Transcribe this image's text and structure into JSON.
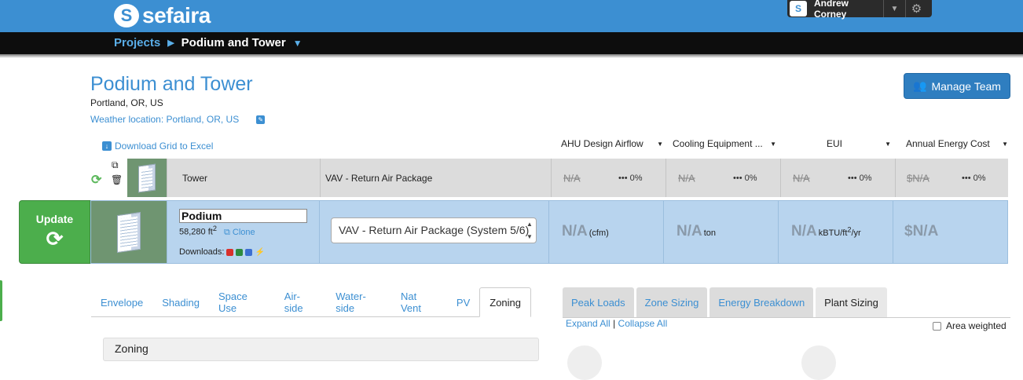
{
  "header": {
    "logo_text": "sefaira",
    "logo_mark": "S",
    "user_name": "Andrew Corney"
  },
  "breadcrumb": {
    "root": "Projects",
    "current": "Podium and Tower"
  },
  "project": {
    "title": "Podium and Tower",
    "location": "Portland, OR, US",
    "weather": "Weather location: Portland, OR, US",
    "manage_team": "Manage Team"
  },
  "grid": {
    "download_label": "Download Grid to Excel",
    "columns": [
      "AHU Design Airflow",
      "Cooling Equipment ...",
      "EUI",
      "Annual Energy Cost"
    ]
  },
  "tower_row": {
    "name": "Tower",
    "hvac": "VAV - Return Air Package",
    "metrics": [
      {
        "value": "N/A",
        "pct": "0%"
      },
      {
        "value": "N/A",
        "pct": "0%"
      },
      {
        "value": "N/A",
        "pct": "0%"
      },
      {
        "value": "$N/A",
        "pct": "0%"
      }
    ]
  },
  "podium_row": {
    "update_label": "Update",
    "name": "Podium",
    "area": "58,280 ft",
    "area_sup": "2",
    "clone": "Clone",
    "downloads_label": "Downloads:",
    "hvac": "VAV - Return Air Package (System 5/6)",
    "metrics": [
      {
        "value": "N/A",
        "unit": "(cfm)"
      },
      {
        "value": "N/A",
        "unit": "ton"
      },
      {
        "value": "N/A",
        "unit": "kBTU/ft",
        "unit_sup": "2",
        "unit_tail": "/yr"
      },
      {
        "value": "$N/A",
        "unit": ""
      }
    ]
  },
  "left_tabs": [
    "Envelope",
    "Shading",
    "Space Use",
    "Air-side",
    "Water-side",
    "Nat Vent",
    "PV",
    "Zoning"
  ],
  "left_active": "Zoning",
  "zoning_panel_title": "Zoning",
  "right_tabs": [
    "Peak Loads",
    "Zone Sizing",
    "Energy Breakdown",
    "Plant Sizing"
  ],
  "right_active": "Plant Sizing",
  "expand_all": "Expand All",
  "expand_sep": "|",
  "collapse_all": "Collapse All",
  "area_weighted": "Area weighted",
  "colors": {
    "brand_blue": "#3c8fd2",
    "update_green": "#4cae4c",
    "row_selected": "#b8d4ee"
  }
}
